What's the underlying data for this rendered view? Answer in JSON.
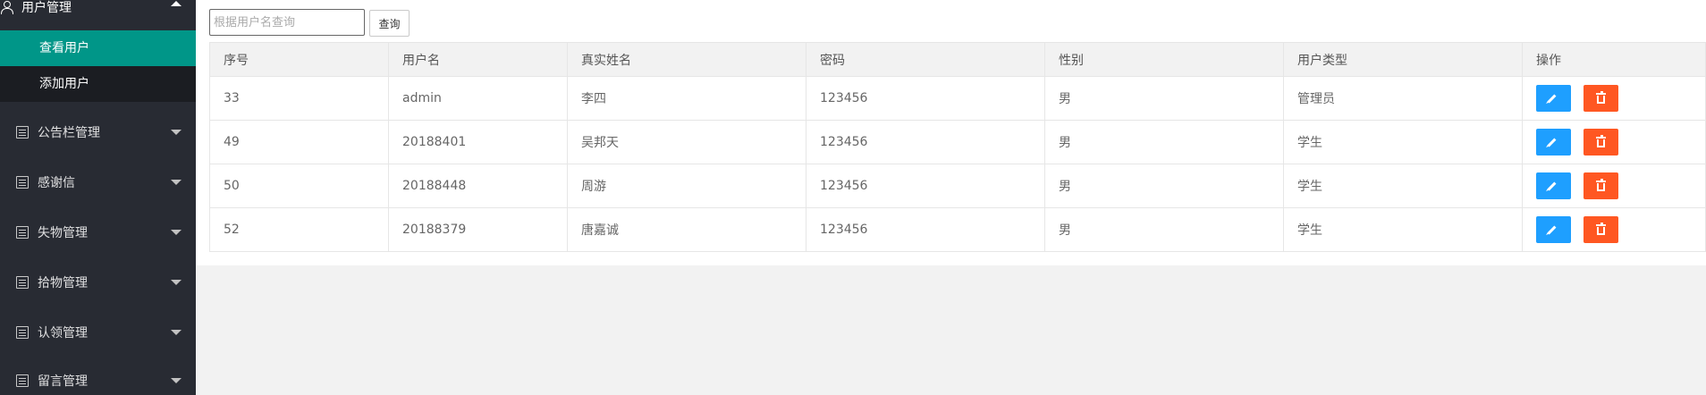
{
  "sidebar": {
    "header": {
      "label": "用户管理",
      "icon": "user-icon"
    },
    "subitems": [
      {
        "label": "查看用户",
        "active": true
      },
      {
        "label": "添加用户",
        "active": false
      }
    ],
    "items": [
      {
        "label": "公告栏管理",
        "icon": "calendar-icon"
      },
      {
        "label": "感谢信",
        "icon": "calendar-icon"
      },
      {
        "label": "失物管理",
        "icon": "calendar-icon"
      },
      {
        "label": "拾物管理",
        "icon": "calendar-icon"
      },
      {
        "label": "认领管理",
        "icon": "calendar-icon"
      },
      {
        "label": "留言管理",
        "icon": "calendar-icon"
      }
    ]
  },
  "search": {
    "placeholder": "根据用户名查询",
    "value": "",
    "button_label": "查询"
  },
  "table": {
    "columns": [
      "序号",
      "用户名",
      "真实姓名",
      "密码",
      "性别",
      "用户类型",
      "操作"
    ],
    "rows": [
      {
        "id": "33",
        "username": "admin",
        "realname": "李四",
        "password": "123456",
        "gender": "男",
        "type": "管理员"
      },
      {
        "id": "49",
        "username": "20188401",
        "realname": "吴邦天",
        "password": "123456",
        "gender": "男",
        "type": "学生"
      },
      {
        "id": "50",
        "username": "20188448",
        "realname": "周游",
        "password": "123456",
        "gender": "男",
        "type": "学生"
      },
      {
        "id": "52",
        "username": "20188379",
        "realname": "唐嘉诚",
        "password": "123456",
        "gender": "男",
        "type": "学生"
      }
    ],
    "actions": {
      "edit_icon": "pencil-icon",
      "delete_icon": "trash-icon"
    }
  },
  "colors": {
    "sidebar_bg": "#282b33",
    "active_item": "#009688",
    "edit_button": "#1e9fff",
    "delete_button": "#ff5722"
  }
}
